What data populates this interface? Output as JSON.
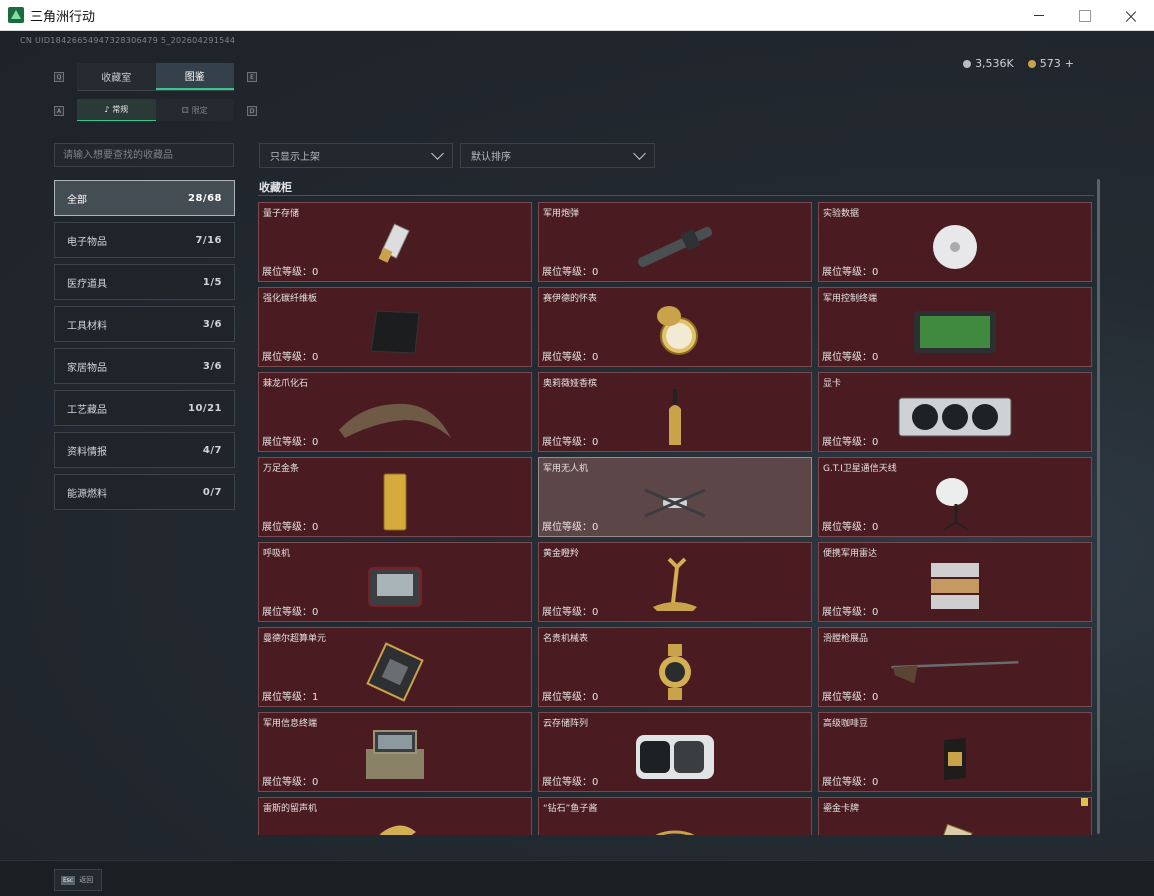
{
  "window": {
    "title": "三角洲行动"
  },
  "uid": "CN UID18426654947328306479 5_202604291544",
  "currency": {
    "silver": "3,536K",
    "gold": "573"
  },
  "tabs": [
    {
      "label": "收藏室"
    },
    {
      "label": "图鉴"
    }
  ],
  "subtabs": [
    {
      "label": "常规"
    },
    {
      "label": "限定"
    }
  ],
  "search": {
    "placeholder": "请输入想要查找的收藏品"
  },
  "filters": {
    "shelf": "只显示上架",
    "sort": "默认排序"
  },
  "section_title": "收藏柜",
  "categories": [
    {
      "label": "全部",
      "count": "28/68"
    },
    {
      "label": "电子物品",
      "count": "7/16"
    },
    {
      "label": "医疗道具",
      "count": "1/5"
    },
    {
      "label": "工具材料",
      "count": "3/6"
    },
    {
      "label": "家居物品",
      "count": "3/6"
    },
    {
      "label": "工艺藏品",
      "count": "10/21"
    },
    {
      "label": "资料情报",
      "count": "4/7"
    },
    {
      "label": "能源燃料",
      "count": "0/7"
    }
  ],
  "level_prefix": "展位等级：",
  "items": [
    {
      "name": "量子存储",
      "level": "0",
      "icon": "usb-drive-icon"
    },
    {
      "name": "军用炮弹",
      "level": "0",
      "icon": "shell-icon"
    },
    {
      "name": "实验数据",
      "level": "0",
      "icon": "disc-icon"
    },
    {
      "name": "强化碳纤维板",
      "level": "0",
      "icon": "plate-icon"
    },
    {
      "name": "赛伊德的怀表",
      "level": "0",
      "icon": "pocket-watch-icon"
    },
    {
      "name": "军用控制终端",
      "level": "0",
      "icon": "terminal-icon"
    },
    {
      "name": "棘龙爪化石",
      "level": "0",
      "icon": "claw-fossil-icon"
    },
    {
      "name": "奥莉薇娅香槟",
      "level": "0",
      "icon": "bottle-icon"
    },
    {
      "name": "显卡",
      "level": "0",
      "icon": "gpu-icon"
    },
    {
      "name": "万足金条",
      "level": "0",
      "icon": "gold-bar-icon"
    },
    {
      "name": "军用无人机",
      "level": "0",
      "icon": "drone-icon"
    },
    {
      "name": "G.T.I卫星通信天线",
      "level": "0",
      "icon": "satellite-dish-icon"
    },
    {
      "name": "呼吸机",
      "level": "0",
      "icon": "ventilator-icon"
    },
    {
      "name": "黄金瞪羚",
      "level": "0",
      "icon": "gazelle-icon"
    },
    {
      "name": "便携军用雷达",
      "level": "0",
      "icon": "radar-icon"
    },
    {
      "name": "曼德尔超算单元",
      "level": "1",
      "icon": "chip-icon"
    },
    {
      "name": "名贵机械表",
      "level": "0",
      "icon": "wristwatch-icon"
    },
    {
      "name": "滑膛枪展品",
      "level": "0",
      "icon": "musket-icon"
    },
    {
      "name": "军用信息终端",
      "level": "0",
      "icon": "case-terminal-icon"
    },
    {
      "name": "云存储阵列",
      "level": "0",
      "icon": "storage-array-icon"
    },
    {
      "name": "高级咖啡豆",
      "level": "0",
      "icon": "coffee-bag-icon"
    },
    {
      "name": "雷斯的留声机",
      "level": "",
      "icon": "gramophone-icon"
    },
    {
      "name": "“钻石”鱼子酱",
      "level": "",
      "icon": "caviar-tin-icon"
    },
    {
      "name": "鎏金卡牌",
      "level": "",
      "icon": "card-icon"
    }
  ],
  "bottom": {
    "esc_key": "Esc",
    "esc_label": "返回"
  }
}
